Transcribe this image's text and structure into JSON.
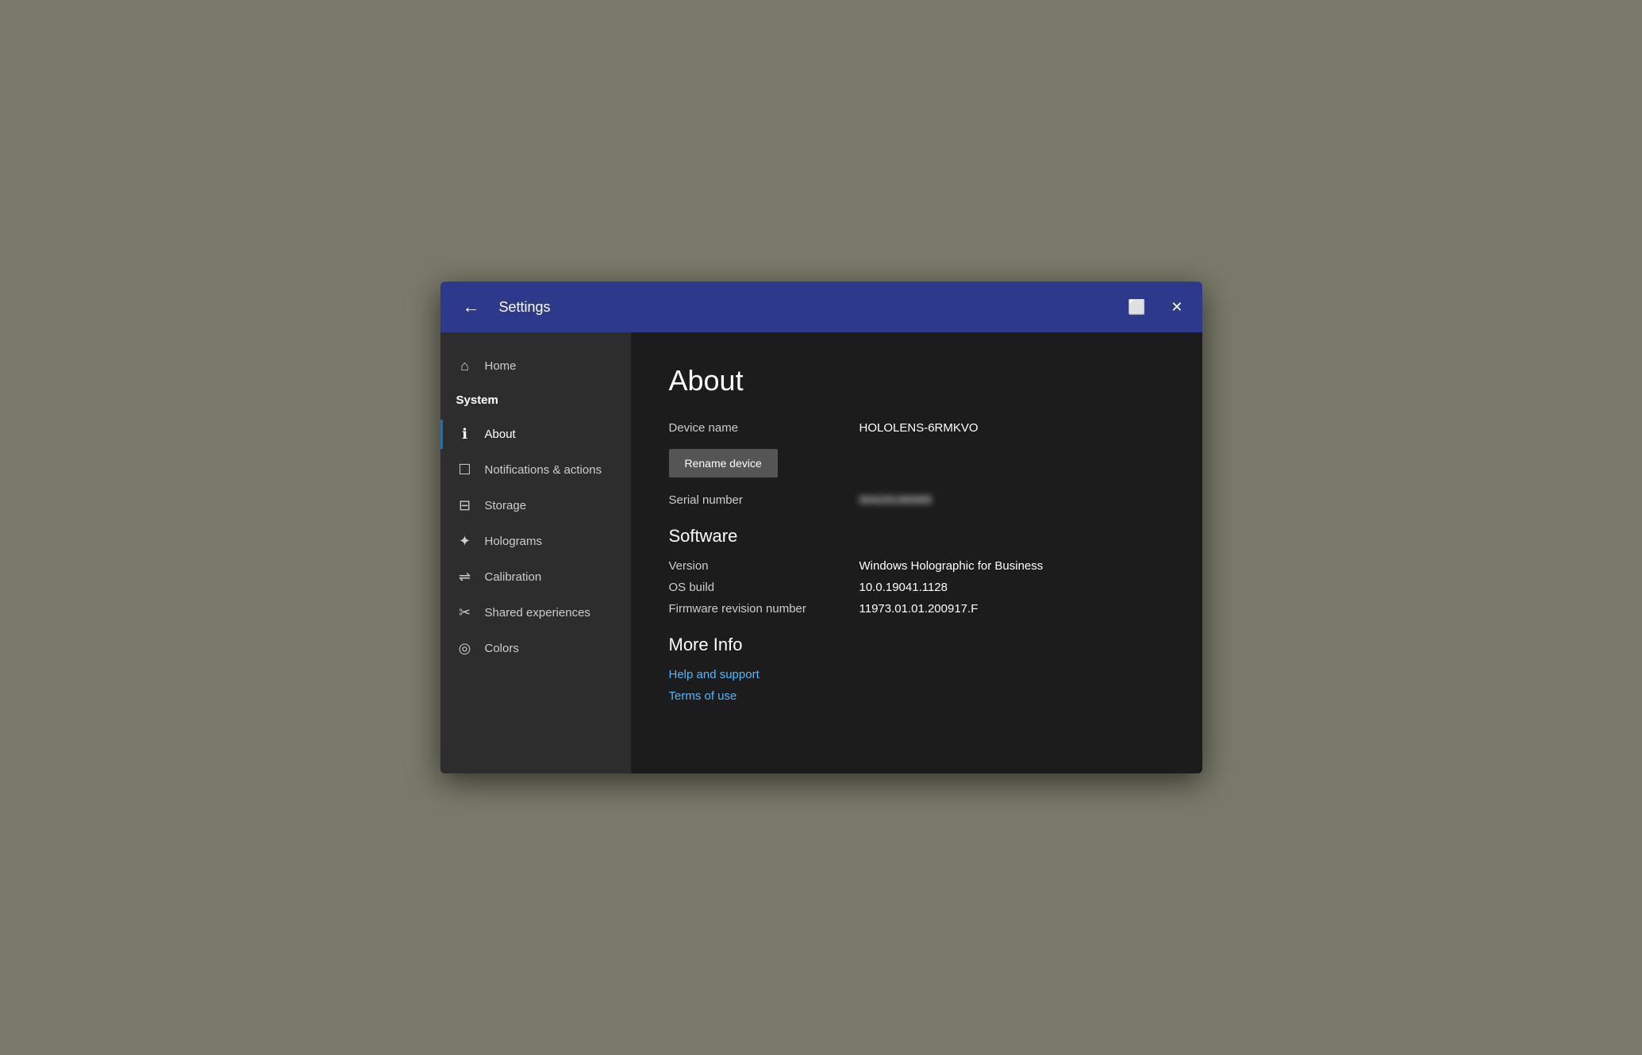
{
  "titlebar": {
    "title": "Settings",
    "back_label": "←",
    "window_icon": "⬜",
    "close_icon": "✕"
  },
  "sidebar": {
    "items": [
      {
        "id": "home",
        "label": "Home",
        "icon": "⌂",
        "type": "nav"
      },
      {
        "id": "system",
        "label": "System",
        "icon": "",
        "type": "header"
      },
      {
        "id": "about",
        "label": "About",
        "icon": "ℹ",
        "type": "nav",
        "active": true
      },
      {
        "id": "notifications",
        "label": "Notifications & actions",
        "icon": "□",
        "type": "nav"
      },
      {
        "id": "storage",
        "label": "Storage",
        "icon": "⊟",
        "type": "nav"
      },
      {
        "id": "holograms",
        "label": "Holograms",
        "icon": "✦",
        "type": "nav"
      },
      {
        "id": "calibration",
        "label": "Calibration",
        "icon": "⇌",
        "type": "nav"
      },
      {
        "id": "shared",
        "label": "Shared experiences",
        "icon": "✂",
        "type": "nav"
      },
      {
        "id": "colors",
        "label": "Colors",
        "icon": "◎",
        "type": "nav"
      }
    ]
  },
  "main": {
    "page_title": "About",
    "device_name_label": "Device name",
    "device_name_value": "HOLOLENS-6RMKVO",
    "rename_button": "Rename device",
    "serial_number_label": "Serial number",
    "serial_number_value": "00429190065",
    "software_title": "Software",
    "version_label": "Version",
    "version_value": "Windows Holographic for Business",
    "os_build_label": "OS build",
    "os_build_value": "10.0.19041.1128",
    "firmware_label": "Firmware revision number",
    "firmware_value": "11973.01.01.200917.F",
    "more_info_title": "More Info",
    "help_link": "Help and support",
    "terms_link": "Terms of use"
  }
}
